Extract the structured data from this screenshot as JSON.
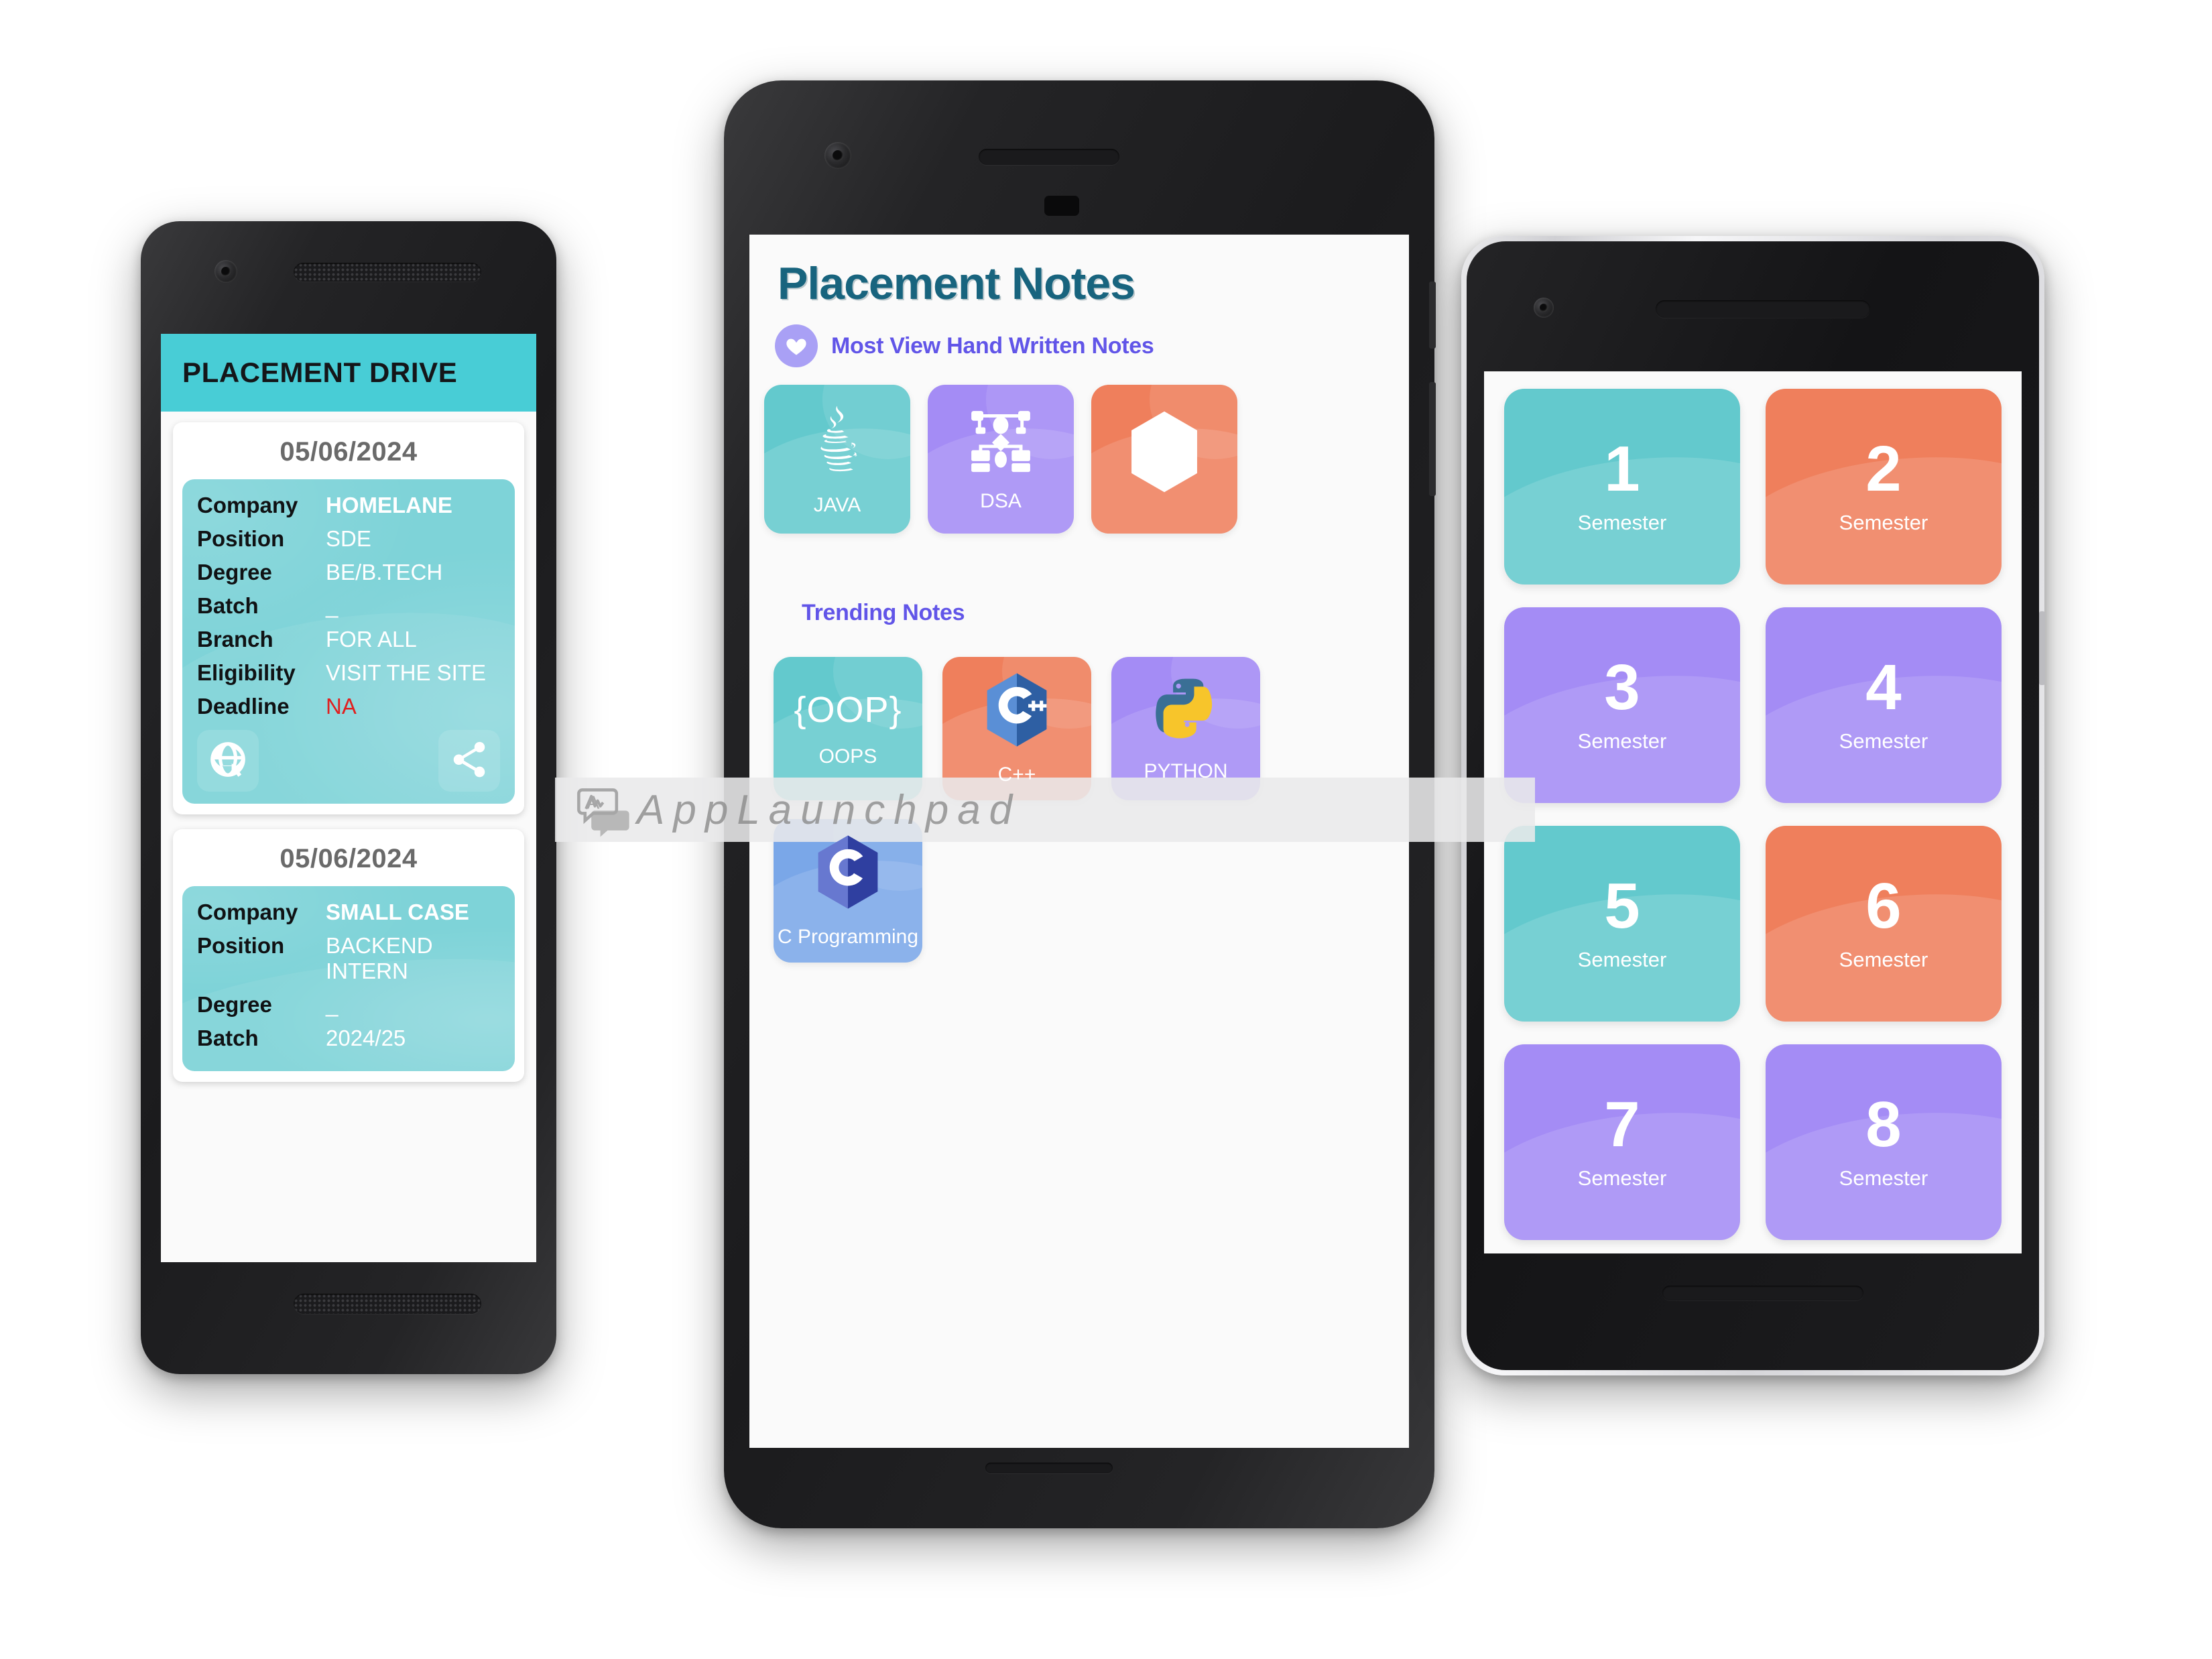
{
  "colors": {
    "appbar_teal": "#48cdd6",
    "card_teal": "#7ed3d8",
    "tile_teal": "#63c9cd",
    "tile_purple": "#a48cf5",
    "tile_orange": "#ef7f5c",
    "tile_blue": "#7aa7e8",
    "title_blue": "#18647e",
    "section_purple": "#6155e8",
    "deadline_red": "#e02020"
  },
  "left_phone": {
    "appbar_title": "PLACEMENT DRIVE",
    "cards": [
      {
        "date": "05/06/2024",
        "fields": [
          {
            "key": "Company",
            "value": "HOMELANE"
          },
          {
            "key": "Position",
            "value": "SDE"
          },
          {
            "key": "Degree",
            "value": "BE/B.TECH"
          },
          {
            "key": "Batch",
            "value": "_"
          },
          {
            "key": "Branch",
            "value": "FOR ALL"
          },
          {
            "key": "Eligibility",
            "value": "VISIT THE SITE"
          },
          {
            "key": "Deadline",
            "value": "NA"
          }
        ],
        "actions": [
          {
            "name": "globe-icon",
            "label": "Visit website"
          },
          {
            "name": "share-icon",
            "label": "Share"
          }
        ]
      },
      {
        "date": "05/06/2024",
        "fields": [
          {
            "key": "Company",
            "value": "SMALL CASE"
          },
          {
            "key": "Position",
            "value": "BACKEND INTERN"
          },
          {
            "key": "Degree",
            "value": "_"
          },
          {
            "key": "Batch",
            "value": "2024/25"
          }
        ]
      }
    ]
  },
  "mid_phone": {
    "title": "Placement Notes",
    "section_most_viewed": {
      "icon": "heart-icon",
      "label": "Most View Hand Written Notes",
      "tiles": [
        {
          "label": "JAVA",
          "icon": "java-icon",
          "color": "teal"
        },
        {
          "label": "DSA",
          "icon": "flowchart-icon",
          "color": "purple"
        },
        {
          "label": "",
          "icon": "c-hexagon-icon",
          "color": "orange"
        }
      ]
    },
    "section_trending": {
      "label": "Trending Notes",
      "tiles": [
        {
          "label": "OOPS",
          "icon": "braces-oop-icon",
          "color": "teal"
        },
        {
          "label": "C++",
          "icon": "cpp-hexagon-icon",
          "color": "orange"
        },
        {
          "label": "PYTHON",
          "icon": "python-icon",
          "color": "purple"
        },
        {
          "label": "C Programming",
          "icon": "c-hexagon-icon",
          "color": "blue"
        }
      ]
    }
  },
  "right_phone": {
    "semester_label": "Semester",
    "tiles": [
      {
        "number": "1",
        "label": "Semester",
        "color": "teal"
      },
      {
        "number": "2",
        "label": "Semester",
        "color": "orange"
      },
      {
        "number": "3",
        "label": "Semester",
        "color": "purple"
      },
      {
        "number": "4",
        "label": "Semester",
        "color": "purple"
      },
      {
        "number": "5",
        "label": "Semester",
        "color": "teal"
      },
      {
        "number": "6",
        "label": "Semester",
        "color": "orange"
      },
      {
        "number": "7",
        "label": "Semester",
        "color": "purple"
      },
      {
        "number": "8",
        "label": "Semester",
        "color": "purple"
      }
    ]
  },
  "watermark": {
    "text": "AppLaunchpad",
    "icon": "speech-bubbles-logo"
  }
}
